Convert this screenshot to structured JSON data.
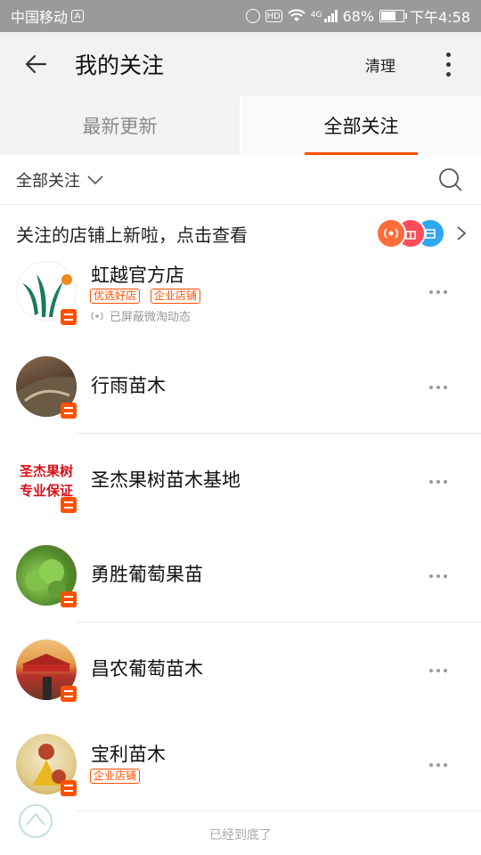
{
  "status_bar": {
    "carrier": "中国移动",
    "carrier_badge": "A",
    "hd": "HD",
    "network": "4G",
    "battery": "68%",
    "battery_level": 0.68,
    "time": "下午4:58"
  },
  "header": {
    "title": "我的关注",
    "clear_label": "清理",
    "back_icon": "back-arrow-icon",
    "more_icon": "more-vertical-icon"
  },
  "tabs": [
    {
      "label": "最新更新",
      "active": false
    },
    {
      "label": "全部关注",
      "active": true
    }
  ],
  "filter": {
    "label": "全部关注"
  },
  "banner": {
    "text": "关注的店铺上新啦，点击查看"
  },
  "shops": [
    {
      "name": "虹越官方店",
      "tags": [
        "优选好店",
        "企业店铺"
      ],
      "muted_note": "已屏蔽微淘动态"
    },
    {
      "name": "行雨苗木",
      "tags": [],
      "muted_note": ""
    },
    {
      "name": "圣杰果树苗木基地",
      "tags": [],
      "muted_note": "",
      "avatar_text": [
        "圣杰果树",
        "专业保证"
      ]
    },
    {
      "name": "勇胜葡萄果苗",
      "tags": [],
      "muted_note": ""
    },
    {
      "name": "昌农葡萄苗木",
      "tags": [],
      "muted_note": ""
    },
    {
      "name": "宝利苗木",
      "tags": [
        "企业店铺"
      ],
      "muted_note": ""
    }
  ],
  "footer": {
    "text": "已经到底了"
  },
  "colors": {
    "accent": "#ff5000",
    "header_bg": "#f2f2f2",
    "status_bar_bg": "#9a9a9a"
  }
}
